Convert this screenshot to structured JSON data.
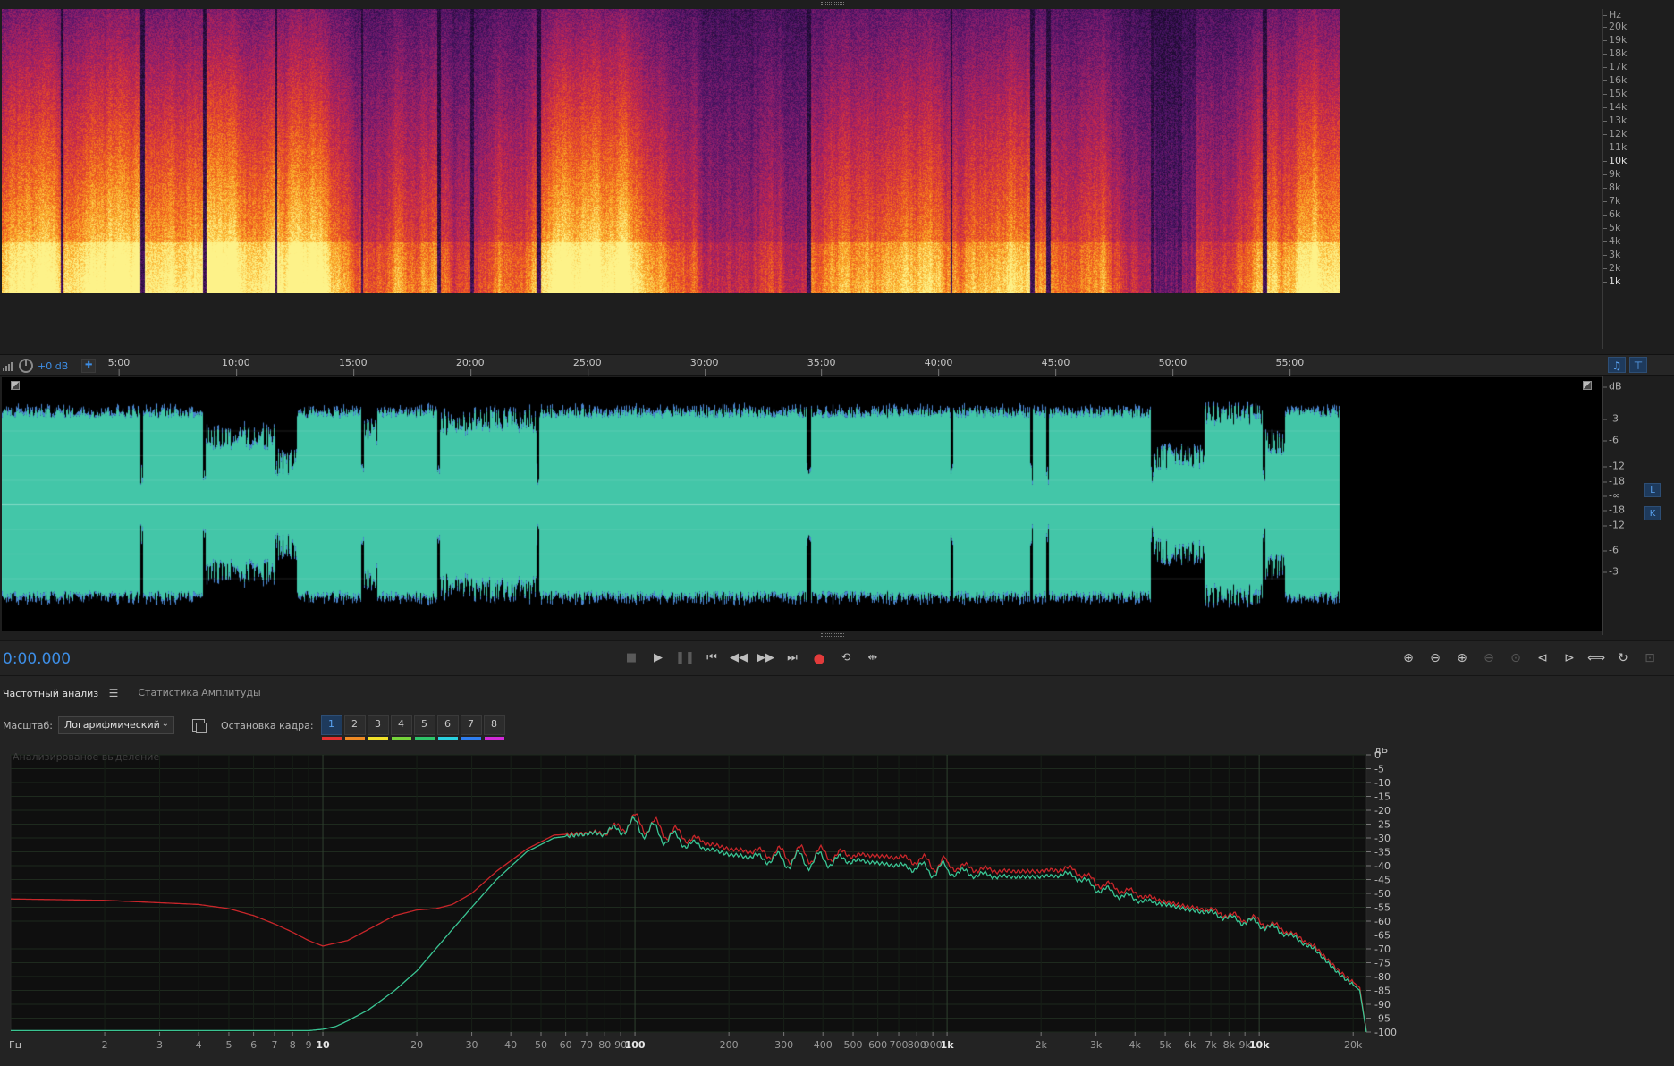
{
  "spectrogram": {
    "unit_label": "Hz",
    "freq_ticks": [
      {
        "label": "20k",
        "kind": "minor"
      },
      {
        "label": "19k",
        "kind": "minor"
      },
      {
        "label": "18k",
        "kind": "minor"
      },
      {
        "label": "17k",
        "kind": "minor"
      },
      {
        "label": "16k",
        "kind": "minor"
      },
      {
        "label": "15k",
        "kind": "minor"
      },
      {
        "label": "14k",
        "kind": "minor"
      },
      {
        "label": "13k",
        "kind": "minor"
      },
      {
        "label": "12k",
        "kind": "minor"
      },
      {
        "label": "11k",
        "kind": "minor"
      },
      {
        "label": "10k",
        "kind": "major"
      },
      {
        "label": "9k",
        "kind": "minor"
      },
      {
        "label": "8k",
        "kind": "minor"
      },
      {
        "label": "7k",
        "kind": "minor"
      },
      {
        "label": "6k",
        "kind": "minor"
      },
      {
        "label": "5k",
        "kind": "minor"
      },
      {
        "label": "4k",
        "kind": "minor"
      },
      {
        "label": "3k",
        "kind": "minor"
      },
      {
        "label": "2k",
        "kind": "minor"
      },
      {
        "label": "1k",
        "kind": "major"
      }
    ],
    "colors": [
      "#1b0b2e",
      "#4a1466",
      "#8a1e6e",
      "#c8284a",
      "#ef5a1e",
      "#fbb02a",
      "#fdf28a"
    ]
  },
  "ruler": {
    "db_value": "+0 dB",
    "time_labels": [
      "5:00",
      "10:00",
      "15:00",
      "20:00",
      "25:00",
      "30:00",
      "35:00",
      "40:00",
      "45:00",
      "50:00",
      "55:00"
    ],
    "total_minutes": 57.2
  },
  "waveform": {
    "unit_label": "dB",
    "upper_ticks": [
      "-3",
      "-6",
      "-12",
      "-18"
    ],
    "center_tick": "-∞",
    "lower_ticks": [
      "-18",
      "-12",
      "-6",
      "-3"
    ],
    "channel_left": "L",
    "channel_right": "K",
    "color": "#43c6a8",
    "edge_color": "#4a86d0"
  },
  "transport": {
    "time": "0:00.000",
    "buttons": [
      {
        "name": "stop-button",
        "glyph": "■",
        "enabled": false
      },
      {
        "name": "play-button",
        "glyph": "▶",
        "enabled": true
      },
      {
        "name": "pause-button",
        "glyph": "❚❚",
        "enabled": false
      },
      {
        "name": "go-to-start-button",
        "glyph": "⏮",
        "enabled": true
      },
      {
        "name": "rewind-button",
        "glyph": "◀◀",
        "enabled": true
      },
      {
        "name": "fast-forward-button",
        "glyph": "▶▶",
        "enabled": true
      },
      {
        "name": "go-to-end-button",
        "glyph": "⏭",
        "enabled": true
      },
      {
        "name": "record-button",
        "glyph": "●",
        "enabled": true,
        "record": true
      },
      {
        "name": "loop-button",
        "glyph": "⟲",
        "enabled": true
      },
      {
        "name": "skip-selection-button",
        "glyph": "⇹",
        "enabled": true
      }
    ],
    "zoom_buttons": [
      {
        "name": "zoom-in-amplitude-icon",
        "glyph": "⊕",
        "enabled": true
      },
      {
        "name": "zoom-out-amplitude-icon",
        "glyph": "⊖",
        "enabled": true
      },
      {
        "name": "zoom-in-time-icon",
        "glyph": "⊕",
        "enabled": true
      },
      {
        "name": "zoom-out-time-icon",
        "glyph": "⊖",
        "enabled": false
      },
      {
        "name": "zoom-to-selection-icon",
        "glyph": "⊙",
        "enabled": false
      },
      {
        "name": "zoom-in-left-icon",
        "glyph": "⊲",
        "enabled": true
      },
      {
        "name": "zoom-in-right-icon",
        "glyph": "⊳",
        "enabled": true
      },
      {
        "name": "zoom-out-full-icon",
        "glyph": "⟺",
        "enabled": true
      },
      {
        "name": "zoom-reset-icon",
        "glyph": "↻",
        "enabled": true
      },
      {
        "name": "zoom-fit-icon",
        "glyph": "⊡",
        "enabled": false
      }
    ]
  },
  "analysis_panel": {
    "tabs": [
      {
        "label": "Частотный анализ",
        "active": true
      },
      {
        "label": "Статистика Амплитуды",
        "active": false
      }
    ],
    "menu_glyph": "☰",
    "scale_label": "Масштаб:",
    "scale_value": "Логарифмический",
    "freeze_label": "Остановка кадра:",
    "frames": [
      {
        "label": "1",
        "color": "#e23030",
        "active": true
      },
      {
        "label": "2",
        "color": "#ef8a24",
        "active": false
      },
      {
        "label": "3",
        "color": "#f2e22a",
        "active": false
      },
      {
        "label": "4",
        "color": "#76d43a",
        "active": false
      },
      {
        "label": "5",
        "color": "#2ec46a",
        "active": false
      },
      {
        "label": "6",
        "color": "#2ad1e0",
        "active": false
      },
      {
        "label": "7",
        "color": "#2f7ef0",
        "active": false
      },
      {
        "label": "8",
        "color": "#d22ad8",
        "active": false
      }
    ],
    "overlay_text": "Анализированое выделение"
  },
  "chart_data": {
    "type": "line",
    "title": "",
    "xlabel": "Гц",
    "ylabel": "дБ",
    "x_scale": "log",
    "xlim": [
      1,
      22050
    ],
    "ylim": [
      -100,
      0
    ],
    "grid": true,
    "x_tick_labels": [
      {
        "v": 2,
        "t": "2"
      },
      {
        "v": 3,
        "t": "3"
      },
      {
        "v": 4,
        "t": "4"
      },
      {
        "v": 5,
        "t": "5"
      },
      {
        "v": 6,
        "t": "6"
      },
      {
        "v": 7,
        "t": "7"
      },
      {
        "v": 8,
        "t": "8"
      },
      {
        "v": 9,
        "t": "9"
      },
      {
        "v": 10,
        "t": "10",
        "major": true
      },
      {
        "v": 20,
        "t": "20"
      },
      {
        "v": 30,
        "t": "30"
      },
      {
        "v": 40,
        "t": "40"
      },
      {
        "v": 50,
        "t": "50"
      },
      {
        "v": 60,
        "t": "60"
      },
      {
        "v": 70,
        "t": "70"
      },
      {
        "v": 80,
        "t": "80"
      },
      {
        "v": 90,
        "t": "90"
      },
      {
        "v": 100,
        "t": "100",
        "major": true
      },
      {
        "v": 200,
        "t": "200"
      },
      {
        "v": 300,
        "t": "300"
      },
      {
        "v": 400,
        "t": "400"
      },
      {
        "v": 500,
        "t": "500"
      },
      {
        "v": 600,
        "t": "600"
      },
      {
        "v": 700,
        "t": "700"
      },
      {
        "v": 800,
        "t": "800"
      },
      {
        "v": 900,
        "t": "900"
      },
      {
        "v": 1000,
        "t": "1k",
        "major": true
      },
      {
        "v": 2000,
        "t": "2k"
      },
      {
        "v": 3000,
        "t": "3k"
      },
      {
        "v": 4000,
        "t": "4k"
      },
      {
        "v": 5000,
        "t": "5k"
      },
      {
        "v": 6000,
        "t": "6k"
      },
      {
        "v": 7000,
        "t": "7k"
      },
      {
        "v": 8000,
        "t": "8k"
      },
      {
        "v": 9000,
        "t": "9k"
      },
      {
        "v": 10000,
        "t": "10k",
        "major": true
      },
      {
        "v": 20000,
        "t": "20k"
      }
    ],
    "y_ticks": [
      0,
      -5,
      -10,
      -15,
      -20,
      -25,
      -30,
      -35,
      -40,
      -45,
      -50,
      -55,
      -60,
      -65,
      -70,
      -75,
      -80,
      -85,
      -90,
      -95,
      -100
    ],
    "series": [
      {
        "color": "#c8262a",
        "x": [
          1,
          2,
          4,
          5,
          6,
          7,
          8,
          9,
          10,
          12,
          14,
          17,
          20,
          23,
          26,
          30,
          36,
          45,
          55,
          65,
          80,
          100,
          130,
          200,
          300,
          500,
          700,
          1000,
          1500,
          2000,
          2500,
          3000,
          4000,
          5000,
          6000,
          7000,
          8000,
          9000,
          10000,
          12000,
          15000,
          18000,
          20000,
          21000,
          22050
        ],
        "y": [
          -52,
          -52.5,
          -54,
          -55.5,
          -58,
          -61,
          -64,
          -67,
          -69,
          -67,
          -63,
          -58,
          -56,
          -55.5,
          -54,
          -50,
          -42,
          -34,
          -29,
          -28.5,
          -28,
          -24,
          -28,
          -34,
          -36,
          -36,
          -37,
          -40,
          -42,
          -42,
          -41,
          -46,
          -50,
          -53,
          -55,
          -56,
          -58,
          -59,
          -60,
          -63,
          -69,
          -78,
          -82,
          -84,
          -100
        ]
      },
      {
        "color": "#3ac493",
        "x": [
          1,
          2,
          4,
          6,
          8,
          9,
          10,
          11,
          12,
          14,
          17,
          20,
          23,
          26,
          30,
          36,
          45,
          55,
          65,
          80,
          100,
          130,
          200,
          300,
          500,
          700,
          1000,
          1500,
          2000,
          2500,
          3000,
          4000,
          5000,
          6000,
          7000,
          8000,
          9000,
          10000,
          12000,
          15000,
          18000,
          20000,
          21000,
          22050
        ],
        "y": [
          -99.5,
          -99.5,
          -99.5,
          -99.5,
          -99.5,
          -99.5,
          -99,
          -98,
          -96,
          -92,
          -85,
          -78,
          -70,
          -63,
          -55,
          -45,
          -35,
          -30,
          -29,
          -28,
          -25.5,
          -30,
          -36,
          -38,
          -38,
          -40,
          -42,
          -44,
          -44,
          -43,
          -48,
          -52,
          -54,
          -56,
          -57,
          -59,
          -60,
          -61,
          -64,
          -70,
          -79,
          -83,
          -85,
          -100
        ]
      }
    ]
  }
}
